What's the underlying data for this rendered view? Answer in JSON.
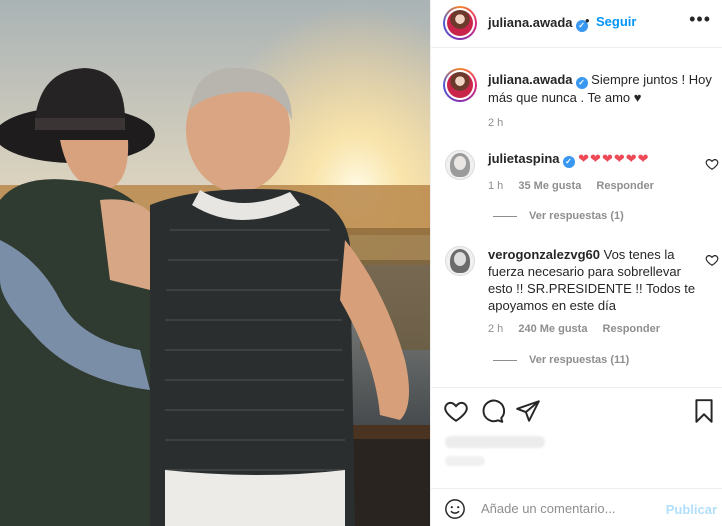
{
  "post": {
    "username": "juliana.awada",
    "follow_label": "Seguir",
    "separator": "•",
    "more_label": "•••",
    "caption_text": "Siempre juntos ! Hoy más que nunca . Te amo",
    "caption_heart": "♥",
    "caption_time": "2 h"
  },
  "comments": [
    {
      "username": "julietaspina",
      "text": "❤❤❤❤❤❤",
      "time": "1 h",
      "likes": "35 Me gusta",
      "reply": "Responder",
      "view_replies": "Ver respuestas (1)"
    },
    {
      "username": "verogonzalezvg60",
      "text": "Vos tenes la fuerza necesario para sobrellevar esto !! SR.PRESIDENTE !! Todos te apoyamos en este día",
      "time": "2 h",
      "likes": "240 Me gusta",
      "reply": "Responder",
      "view_replies": "Ver respuestas (11)"
    }
  ],
  "add_comment": {
    "placeholder": "Añade un comentario...",
    "publish_label": "Publicar"
  },
  "icons": {
    "verified": "verified-badge-icon",
    "like": "heart-outline-icon",
    "comment": "speech-bubble-icon",
    "share": "paper-plane-icon",
    "save": "bookmark-icon",
    "emoji": "smiley-face-icon"
  },
  "colors": {
    "accent": "#0095f6",
    "verified": "#3897f0",
    "heart": "#ed4956",
    "muted": "#8e8e8e",
    "publish_disabled": "#b2dffc"
  }
}
